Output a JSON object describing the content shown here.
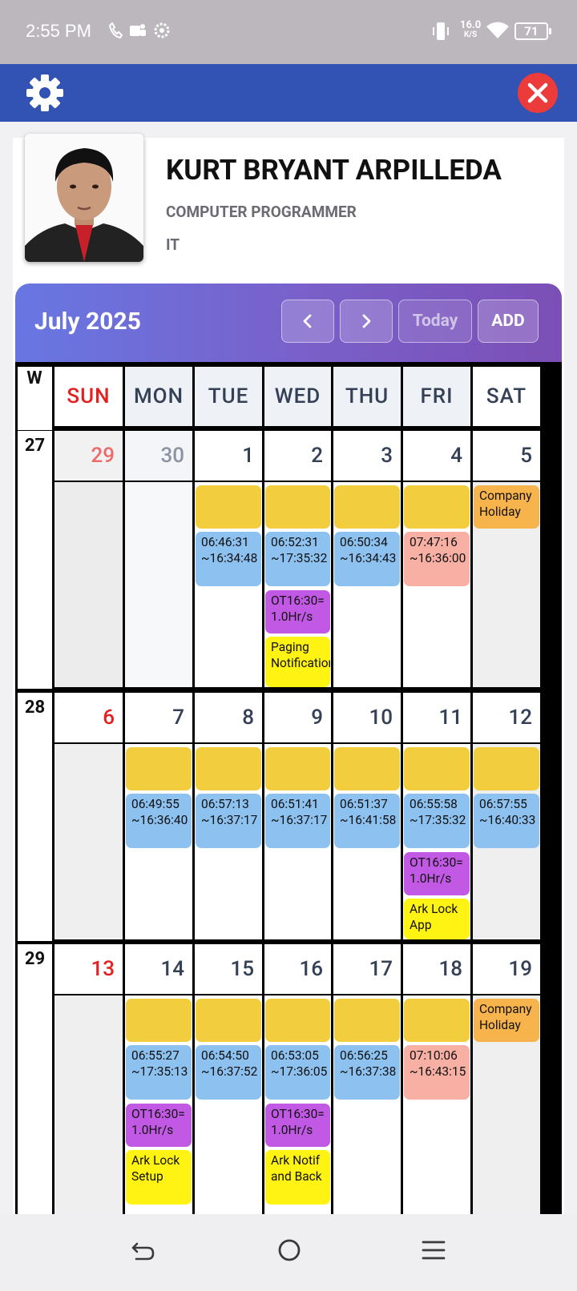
{
  "status": {
    "time": "2:55 PM",
    "speed_value": "16.0",
    "speed_unit": "K/S",
    "battery": "71"
  },
  "profile": {
    "name": "KURT BRYANT ARPILLEDA",
    "title": "COMPUTER PROGRAMMER",
    "dept": "IT"
  },
  "calendar": {
    "month_label": "July 2025",
    "prev_label": "<",
    "next_label": ">",
    "today_label": "Today",
    "add_label": "ADD",
    "week_col_label": "W",
    "day_headers": [
      "SUN",
      "MON",
      "TUE",
      "WED",
      "THU",
      "FRI",
      "SAT"
    ],
    "weeks": [
      {
        "week": "27",
        "days": [
          "29",
          "30",
          "1",
          "2",
          "3",
          "4",
          "5"
        ]
      },
      {
        "week": "28",
        "days": [
          "6",
          "7",
          "8",
          "9",
          "10",
          "11",
          "12"
        ]
      },
      {
        "week": "29",
        "days": [
          "13",
          "14",
          "15",
          "16",
          "17",
          "18",
          "19"
        ]
      }
    ],
    "events": [
      {
        "week": 0,
        "day": 2,
        "slot": 0,
        "text": ""
      },
      {
        "week": 0,
        "day": 3,
        "slot": 0,
        "text": ""
      },
      {
        "week": 0,
        "day": 4,
        "slot": 0,
        "text": ""
      },
      {
        "week": 0,
        "day": 5,
        "slot": 0,
        "text": ""
      },
      {
        "week": 0,
        "day": 6,
        "slot": 0,
        "text": "Company Holiday",
        "kind": "holiday"
      },
      {
        "week": 0,
        "day": 2,
        "slot": 1,
        "text": "06:46:31 ~16:34:48",
        "kind": "time"
      },
      {
        "week": 0,
        "day": 3,
        "slot": 1,
        "text": "06:52:31 ~17:35:32",
        "kind": "time"
      },
      {
        "week": 0,
        "day": 4,
        "slot": 1,
        "text": "06:50:34 ~16:34:43",
        "kind": "time"
      },
      {
        "week": 0,
        "day": 5,
        "slot": 1,
        "text": "07:47:16 ~16:36:00",
        "kind": "late"
      },
      {
        "week": 0,
        "day": 3,
        "slot": 2,
        "text": "OT16:30= 1.0Hr/s",
        "kind": "ot"
      },
      {
        "week": 0,
        "day": 3,
        "slot": 3,
        "text": "Paging Notification",
        "kind": "task"
      },
      {
        "week": 1,
        "day": 1,
        "slot": 0,
        "text": ""
      },
      {
        "week": 1,
        "day": 2,
        "slot": 0,
        "text": ""
      },
      {
        "week": 1,
        "day": 3,
        "slot": 0,
        "text": ""
      },
      {
        "week": 1,
        "day": 4,
        "slot": 0,
        "text": ""
      },
      {
        "week": 1,
        "day": 5,
        "slot": 0,
        "text": ""
      },
      {
        "week": 1,
        "day": 6,
        "slot": 0,
        "text": ""
      },
      {
        "week": 1,
        "day": 1,
        "slot": 1,
        "text": "06:49:55 ~16:36:40",
        "kind": "time"
      },
      {
        "week": 1,
        "day": 2,
        "slot": 1,
        "text": "06:57:13 ~16:37:17",
        "kind": "time"
      },
      {
        "week": 1,
        "day": 3,
        "slot": 1,
        "text": "06:51:41 ~16:37:17",
        "kind": "time"
      },
      {
        "week": 1,
        "day": 4,
        "slot": 1,
        "text": "06:51:37 ~16:41:58",
        "kind": "time"
      },
      {
        "week": 1,
        "day": 5,
        "slot": 1,
        "text": "06:55:58 ~17:35:32",
        "kind": "time"
      },
      {
        "week": 1,
        "day": 6,
        "slot": 1,
        "text": "06:57:55 ~16:40:33",
        "kind": "time"
      },
      {
        "week": 1,
        "day": 5,
        "slot": 2,
        "text": "OT16:30= 1.0Hr/s",
        "kind": "ot"
      },
      {
        "week": 1,
        "day": 5,
        "slot": 3,
        "text": "Ark Lock App",
        "kind": "task"
      },
      {
        "week": 2,
        "day": 1,
        "slot": 0,
        "text": ""
      },
      {
        "week": 2,
        "day": 2,
        "slot": 0,
        "text": ""
      },
      {
        "week": 2,
        "day": 3,
        "slot": 0,
        "text": ""
      },
      {
        "week": 2,
        "day": 4,
        "slot": 0,
        "text": ""
      },
      {
        "week": 2,
        "day": 5,
        "slot": 0,
        "text": ""
      },
      {
        "week": 2,
        "day": 6,
        "slot": 0,
        "text": "Company Holiday",
        "kind": "holiday"
      },
      {
        "week": 2,
        "day": 1,
        "slot": 1,
        "text": "06:55:27 ~17:35:13",
        "kind": "time"
      },
      {
        "week": 2,
        "day": 2,
        "slot": 1,
        "text": "06:54:50 ~16:37:52",
        "kind": "time"
      },
      {
        "week": 2,
        "day": 3,
        "slot": 1,
        "text": "06:53:05 ~17:36:05",
        "kind": "time"
      },
      {
        "week": 2,
        "day": 4,
        "slot": 1,
        "text": "06:56:25 ~16:37:38",
        "kind": "time"
      },
      {
        "week": 2,
        "day": 5,
        "slot": 1,
        "text": "07:10:06 ~16:43:15",
        "kind": "late"
      },
      {
        "week": 2,
        "day": 1,
        "slot": 2,
        "text": "OT16:30= 1.0Hr/s",
        "kind": "ot"
      },
      {
        "week": 2,
        "day": 3,
        "slot": 2,
        "text": "OT16:30= 1.0Hr/s",
        "kind": "ot"
      },
      {
        "week": 2,
        "day": 1,
        "slot": 3,
        "text": "Ark Lock Setup",
        "kind": "task"
      },
      {
        "week": 2,
        "day": 3,
        "slot": 3,
        "text": "Ark Notif and Back",
        "kind": "task"
      }
    ]
  },
  "colors": {
    "appbar": "#3252b4",
    "close": "#ec3b3b",
    "sunday": "#e61e1e",
    "blank_event": "#f2cd3e",
    "holiday": "#f8b44c",
    "time": "#8cc1f0",
    "late": "#f8b0a4",
    "ot": "#c159e5",
    "task": "#fff314"
  },
  "icons": [
    "gear-icon",
    "close-icon",
    "chevron-left-icon",
    "chevron-right-icon",
    "back-icon",
    "home-icon",
    "menu-icon",
    "wifi-icon",
    "vibrate-icon"
  ]
}
